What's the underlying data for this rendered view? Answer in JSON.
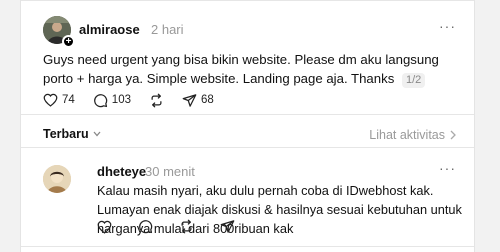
{
  "post": {
    "username": "almiraose",
    "time": "2 hari",
    "more": "···",
    "text": "Guys need urgent yang bisa bikin website. Please dm aku langsung porto + harga ya. Simple website. Landing page aja. Thanks",
    "page_indicator": "1/2",
    "likes": "74",
    "replies": "103",
    "shares": "68"
  },
  "sort": {
    "label": "Terbaru"
  },
  "activity": {
    "label": "Lihat aktivitas"
  },
  "reply": {
    "username": "dheteye",
    "time": "30 menit",
    "more": "···",
    "text": "Kalau masih nyari, aku dulu pernah coba di IDwebhost kak. Lumayan enak diajak diskusi & hasilnya sesuai kebutuhan untuk harganya mulai dari 800ribuan kak"
  },
  "icons": {
    "like": "heart-icon",
    "reply": "comment-icon",
    "repost": "repost-icon",
    "share": "send-icon",
    "more": "more-icon",
    "chevron": "chevron-icon"
  }
}
